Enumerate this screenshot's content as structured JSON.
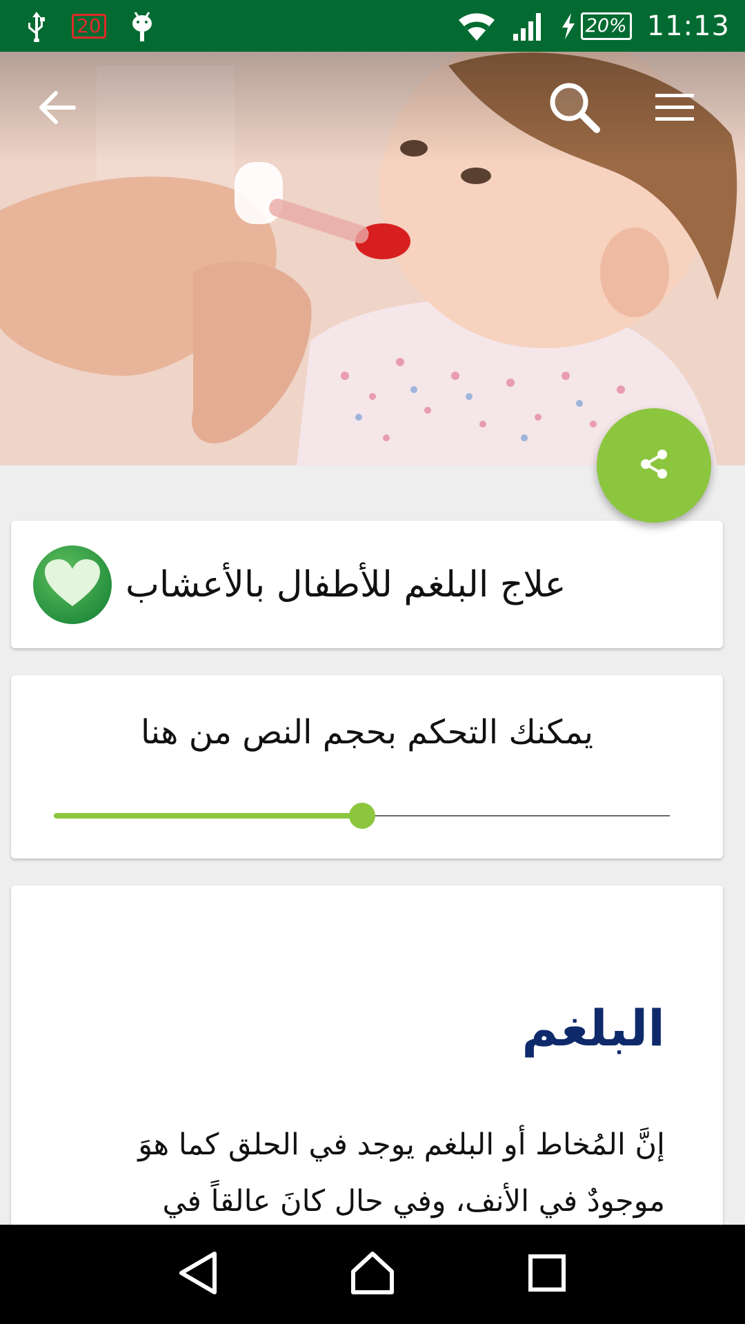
{
  "status_bar": {
    "notification_count": "20",
    "battery_percent": "20%",
    "time": "11:13",
    "icons": [
      "usb-icon",
      "notification-icon",
      "android-debug-icon",
      "wifi-icon",
      "signal-icon",
      "charging-icon",
      "battery-icon"
    ]
  },
  "appbar": {
    "icons": [
      "back-arrow-icon",
      "search-icon",
      "menu-icon"
    ]
  },
  "article": {
    "title": "علاج البلغم للأطفال بالأعشاب",
    "heading": "البلغم",
    "body": "إنَّ المُخاط أو البلغم يوجد في الحلق كما هوَ موجودٌ في الأنف، وفي حال كانَ عالقاً في"
  },
  "text_size": {
    "label": "يمكنك التحكم بحجم النص من هنا",
    "value_fraction": 0.5
  },
  "colors": {
    "status_bar": "#036b31",
    "accent": "#8cc63f",
    "heading": "#0f2a6b",
    "nav_bar": "#000000"
  },
  "fab": {
    "icon": "share-icon"
  },
  "nav": {
    "icons": [
      "nav-back-icon",
      "nav-home-icon",
      "nav-recents-icon"
    ]
  }
}
